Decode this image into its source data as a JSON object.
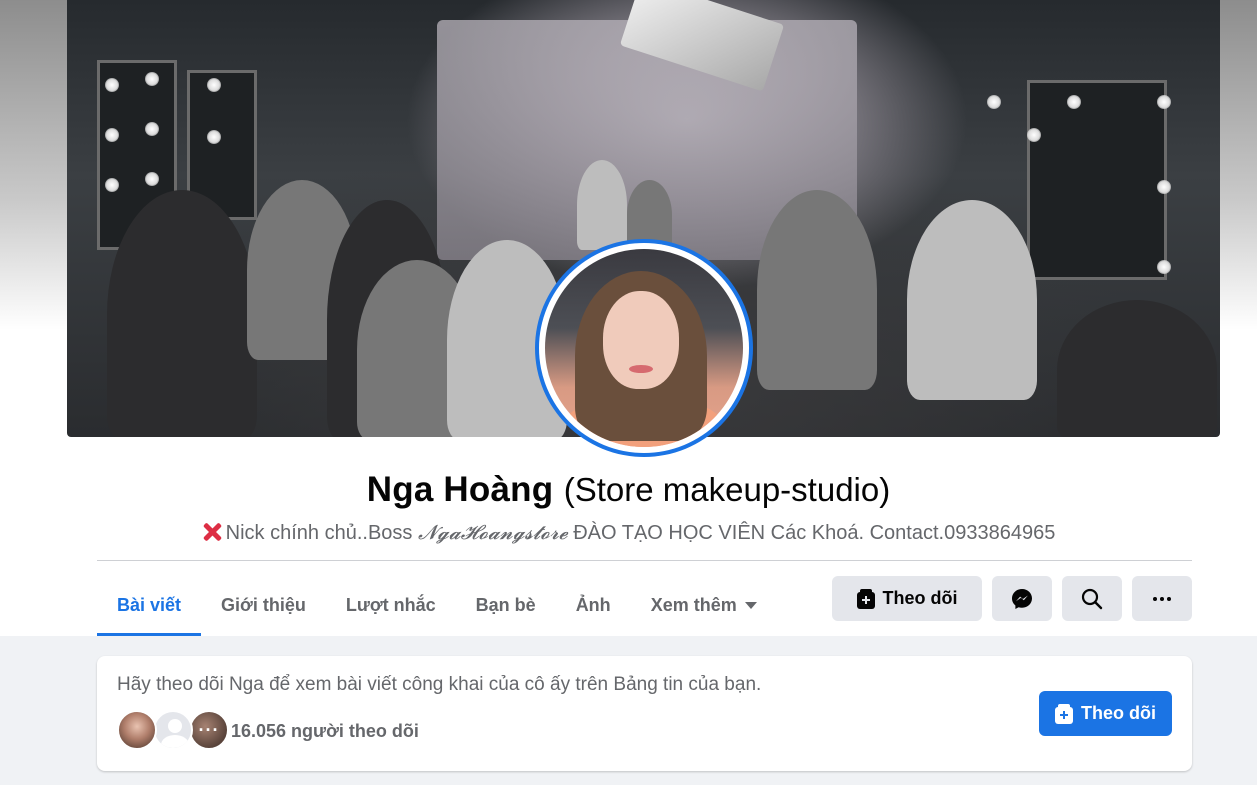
{
  "profile": {
    "name": "Nga Hoàng",
    "alternate_name": "(Store makeup-studio)",
    "bio_icon": "cross-mark-icon",
    "bio_part1": "Nick chính chủ..Boss ",
    "bio_script": "𝓝𝓰𝓪𝓗𝓸𝓪𝓷𝓰𝓼𝓽𝓸𝓻𝓮",
    "bio_part2": " ĐÀO TẠO HỌC VIÊN Các Khoá. Contact.0933864965"
  },
  "tabs": [
    {
      "label": "Bài viết",
      "active": true
    },
    {
      "label": "Giới thiệu"
    },
    {
      "label": "Lượt nhắc"
    },
    {
      "label": "Bạn bè"
    },
    {
      "label": "Ảnh"
    },
    {
      "label": "Xem thêm"
    }
  ],
  "actions": {
    "follow_label": "Theo dõi",
    "messenger_icon": "messenger-icon",
    "search_icon": "search-icon",
    "more_icon": "more-icon"
  },
  "follow_card": {
    "prompt": "Hãy theo dõi Nga để xem bài viết công khai của cô ấy trên Bảng tin của bạn.",
    "follower_count": "16.056 người theo dõi",
    "more_dots": "···",
    "follow_label": "Theo dõi"
  },
  "colors": {
    "accent": "#1b74e4",
    "text_primary": "#050505",
    "text_secondary": "#65676b",
    "button_grey": "#e4e6eb",
    "page_bg": "#f0f2f5"
  }
}
